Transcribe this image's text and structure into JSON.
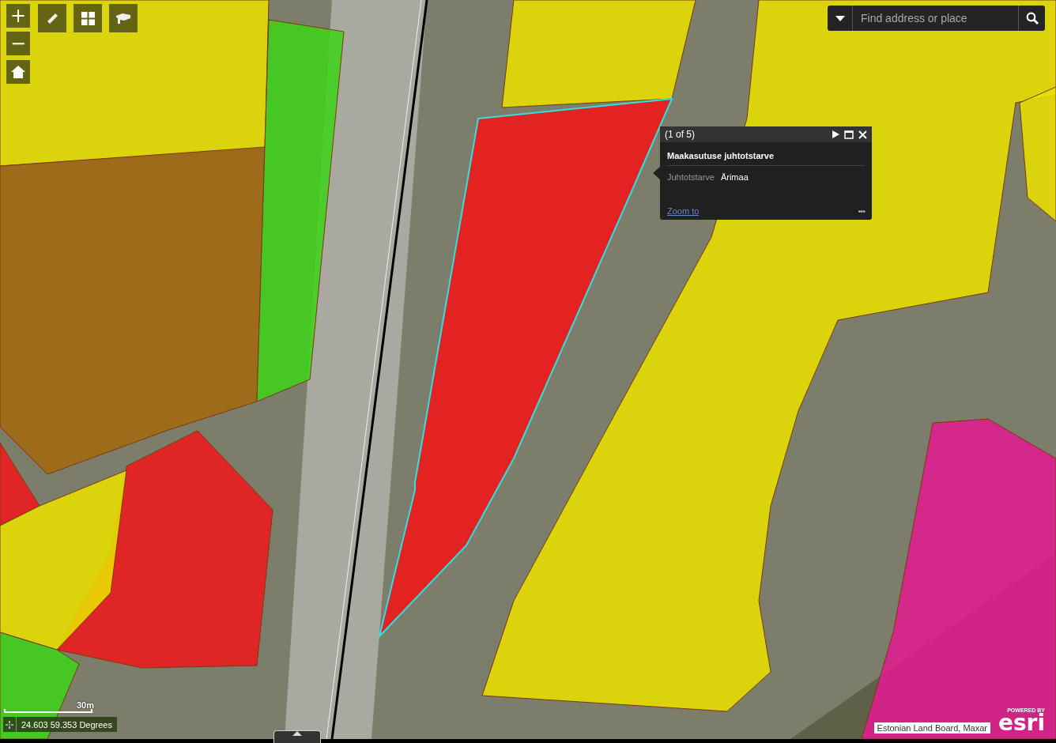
{
  "zoom_controls": {
    "zoom_in": "+",
    "zoom_out": "−"
  },
  "search": {
    "placeholder": "Find address or place"
  },
  "popup": {
    "counter": "(1 of 5)",
    "title": "Maakasutuse juhtotstarve",
    "fields": [
      {
        "label": "Juhtotstarve",
        "value": "Ärimaa"
      }
    ],
    "link": "Zoom to",
    "more": "•••"
  },
  "scale": {
    "label": "30m"
  },
  "coordinates": {
    "text": "24.603 59.353 Degrees"
  },
  "attribution": "Estonian Land Board, Maxar",
  "logo": {
    "tagline": "POWERED BY",
    "wordmark": "esri"
  }
}
